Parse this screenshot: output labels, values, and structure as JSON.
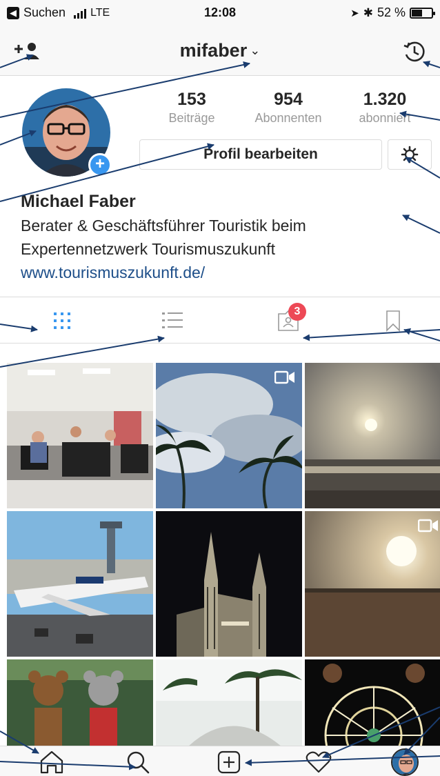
{
  "status_bar": {
    "carrier": "Suchen",
    "network": "LTE",
    "time": "12:08",
    "battery_text": "52 %",
    "battery_level": 0.52
  },
  "header": {
    "username": "mifaber",
    "chevron": "⌄",
    "add_person_icon": "add-person-icon",
    "archive_icon": "archive-history-icon"
  },
  "profile": {
    "avatar_badge": "+",
    "stats": [
      {
        "value": "153",
        "label": "Beiträge"
      },
      {
        "value": "954",
        "label": "Abonnenten"
      },
      {
        "value": "1.320",
        "label": "abonniert"
      }
    ],
    "edit_button": "Profil bearbeiten",
    "settings_icon": "gear-icon"
  },
  "bio": {
    "name": "Michael Faber",
    "text": "Berater & Geschäftsführer Touristik beim Expertennetzwerk Tourismuszukunft",
    "link": "www.tourismuszukunft.de/"
  },
  "tabs": {
    "items": [
      "grid-view-icon",
      "list-view-icon",
      "tagged-photos-icon",
      "saved-bookmark-icon"
    ],
    "tagged_badge": "3"
  },
  "grid": {
    "posts": [
      {
        "subject": "seminar-room-photo",
        "video": false
      },
      {
        "subject": "palm-trees-clouds-photo",
        "video": true
      },
      {
        "subject": "sunset-beach-photo",
        "video": false
      },
      {
        "subject": "airplane-airport-photo",
        "video": false
      },
      {
        "subject": "cathedral-night-photo",
        "video": false
      },
      {
        "subject": "sunset-field-photo",
        "video": true
      },
      {
        "subject": "teddy-bears-photo",
        "video": false
      },
      {
        "subject": "palm-garden-photo",
        "video": false
      },
      {
        "subject": "ferris-wheel-lights-photo",
        "video": false
      }
    ]
  },
  "bottom_bar": {
    "items": [
      "home-icon",
      "search-icon",
      "add-post-icon",
      "activity-heart-icon",
      "profile-avatar"
    ]
  },
  "colors": {
    "accent_blue": "#3897f0",
    "link_blue": "#1d4e89",
    "badge_red": "#ed4956",
    "annotation_line": "#1a3c6e",
    "divider": "#dbdbdb"
  }
}
